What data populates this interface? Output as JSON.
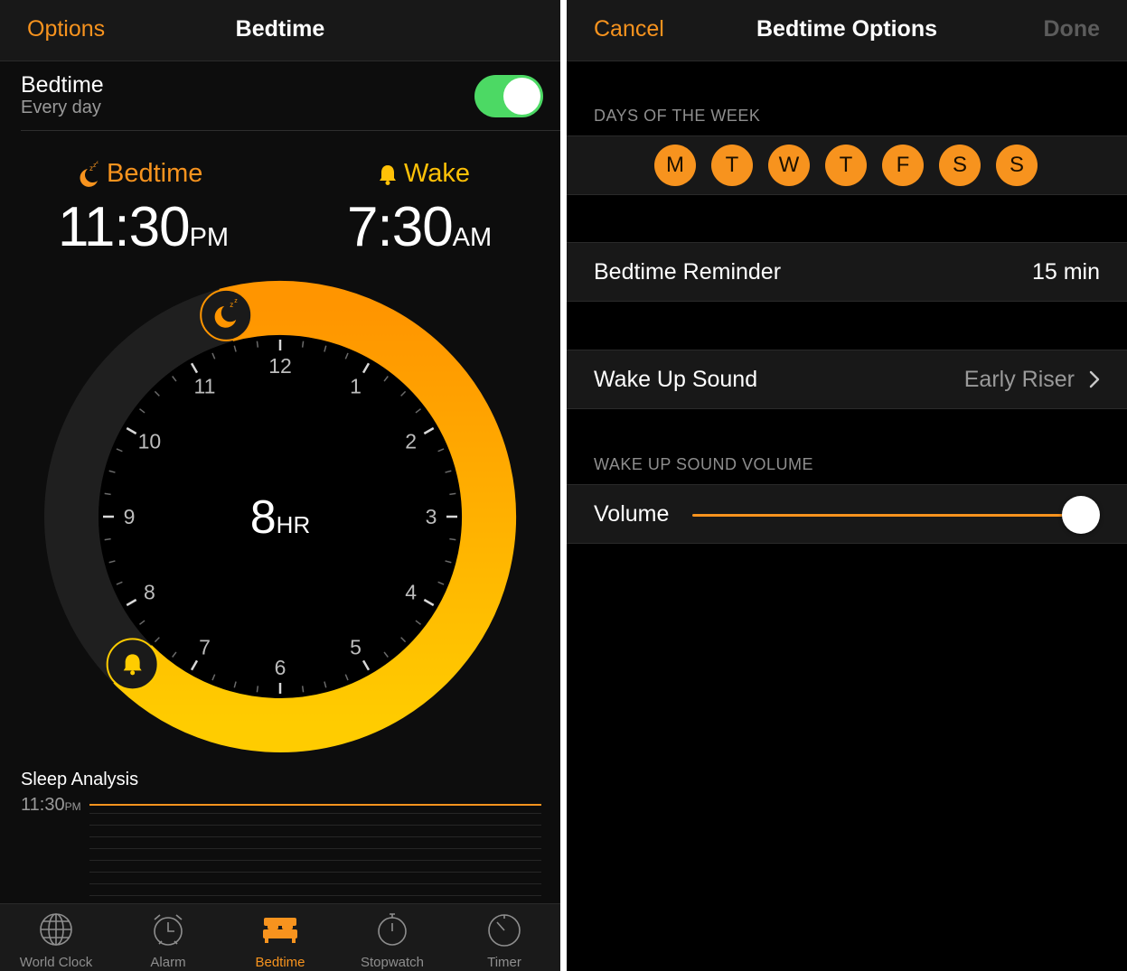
{
  "left": {
    "nav": {
      "left": "Options",
      "title": "Bedtime"
    },
    "bedtime_row": {
      "title": "Bedtime",
      "subtitle": "Every day",
      "enabled": true
    },
    "bedtime": {
      "label": "Bedtime",
      "time": "11:30",
      "ampm": "PM",
      "icon": "moon-zzz-icon"
    },
    "wake": {
      "label": "Wake",
      "time": "7:30",
      "ampm": "AM",
      "icon": "bell-icon"
    },
    "dial": {
      "duration": "8",
      "duration_unit": "HR",
      "hour_labels": [
        "12",
        "1",
        "2",
        "3",
        "4",
        "5",
        "6",
        "7",
        "8",
        "9",
        "10",
        "11"
      ],
      "bedtime_hour": 23.5,
      "wake_hour": 7.5,
      "colors": {
        "start": "#ff9500",
        "end": "#ffcc00",
        "track": "#1f1f1f",
        "face": "#000000"
      }
    },
    "sleep_analysis": {
      "title": "Sleep Analysis",
      "time": "11:30",
      "ampm": "PM"
    },
    "tabs": [
      {
        "label": "World Clock",
        "icon": "globe-icon"
      },
      {
        "label": "Alarm",
        "icon": "alarm-clock-icon"
      },
      {
        "label": "Bedtime",
        "icon": "bed-icon",
        "active": true
      },
      {
        "label": "Stopwatch",
        "icon": "stopwatch-icon"
      },
      {
        "label": "Timer",
        "icon": "timer-icon"
      }
    ]
  },
  "right": {
    "nav": {
      "left": "Cancel",
      "title": "Bedtime Options",
      "right": "Done"
    },
    "days_header": "DAYS OF THE WEEK",
    "days": [
      "M",
      "T",
      "W",
      "T",
      "F",
      "S",
      "S"
    ],
    "reminder": {
      "label": "Bedtime Reminder",
      "value": "15 min"
    },
    "wake_sound": {
      "label": "Wake Up Sound",
      "value": "Early Riser"
    },
    "volume_header": "WAKE UP SOUND VOLUME",
    "volume": {
      "label": "Volume",
      "level": 0.94
    }
  },
  "colors": {
    "accent": "#f7931e",
    "toggle_on": "#4cd964",
    "wake": "#ffc107"
  }
}
